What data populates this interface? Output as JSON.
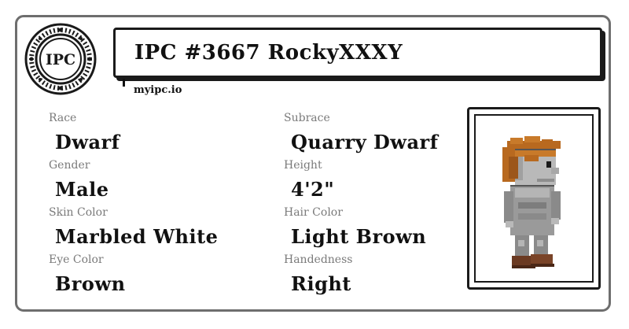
{
  "card": {
    "logo_text": "IPC",
    "title": "IPC #3667 RockyXXXY",
    "site": "myipc.io"
  },
  "fields": {
    "race": {
      "label": "Race",
      "value": "Dwarf"
    },
    "subrace": {
      "label": "Subrace",
      "value": "Quarry Dwarf"
    },
    "gender": {
      "label": "Gender",
      "value": "Male"
    },
    "height": {
      "label": "Height",
      "value": "4'2\""
    },
    "skin_color": {
      "label": "Skin Color",
      "value": "Marbled White"
    },
    "hair_color": {
      "label": "Hair Color",
      "value": "Light Brown"
    },
    "eye_color": {
      "label": "Eye Color",
      "value": "Brown"
    },
    "handedness": {
      "label": "Handedness",
      "value": "Right"
    }
  },
  "colors": {
    "border": "#6e6e6e",
    "label": "#7a7a7a",
    "text": "#111111",
    "hair": "#b8691f",
    "skin": "#b9b9b9",
    "armor": "#8a8a8a",
    "boots": "#6b3a22"
  },
  "icons": {
    "logo": "ipc-seal-logo",
    "portrait": "dwarf-character-sprite"
  }
}
